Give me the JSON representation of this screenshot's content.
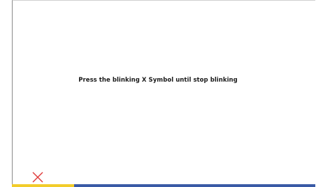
{
  "screen": {
    "instruction": "Press the blinking X Symbol until stop blinking"
  },
  "close_symbol": {
    "icon": "close-icon",
    "color": "#e03a3a"
  },
  "progress": {
    "fraction": 0.205,
    "fill_color": "#f2cc2a",
    "track_color": "#3a5aa6"
  }
}
